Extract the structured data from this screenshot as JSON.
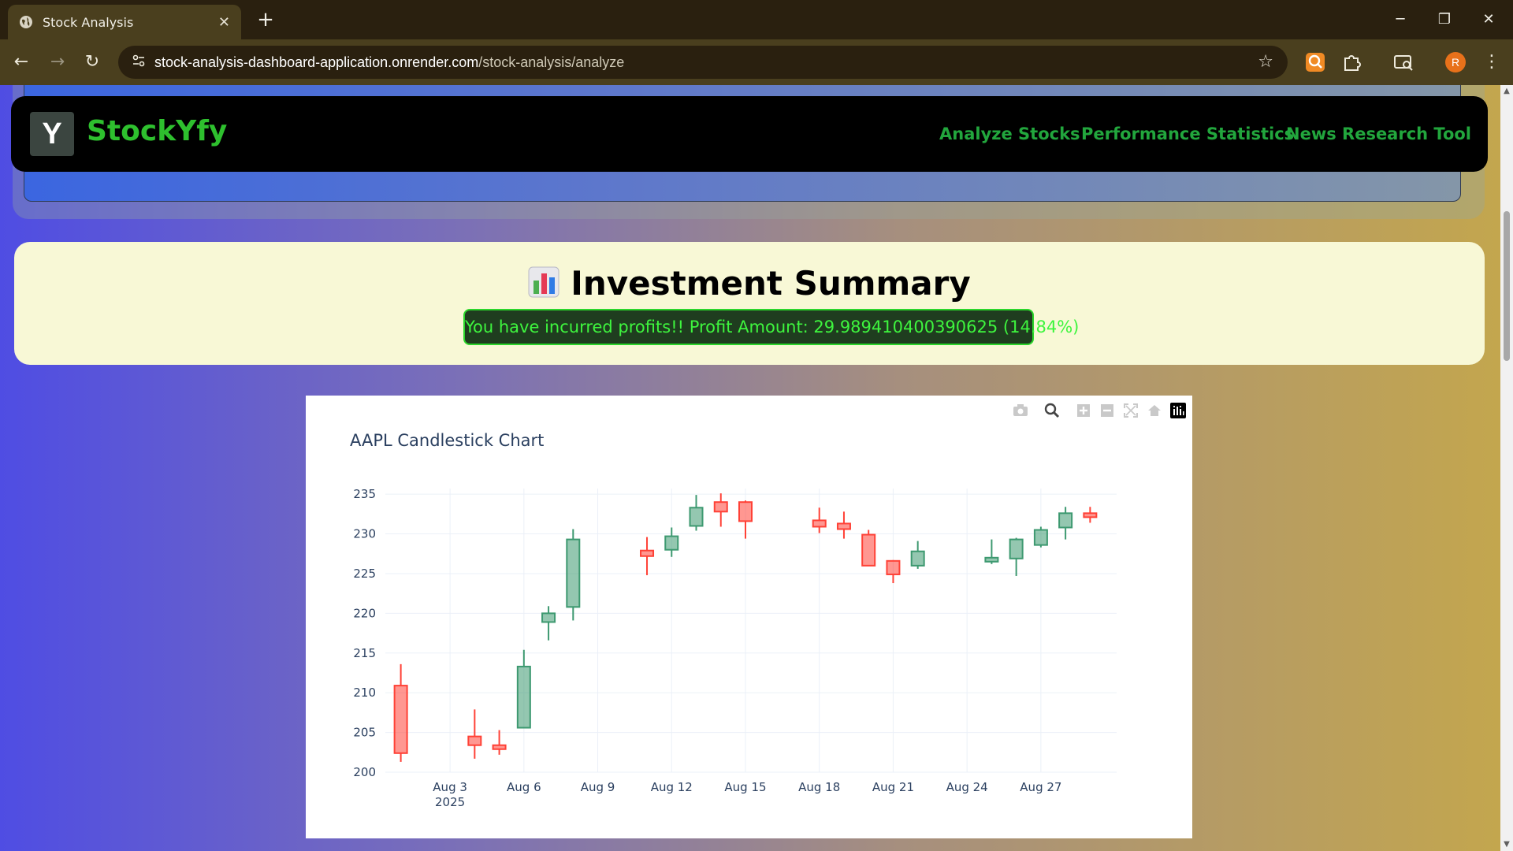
{
  "browser": {
    "tab_title": "Stock Analysis",
    "url_host": "stock-analysis-dashboard-application.onrender.com",
    "url_path": "/stock-analysis/analyze",
    "avatar_letter": "R"
  },
  "navbar": {
    "logo_letter": "Y",
    "brand": "StockYfy",
    "links": [
      "Analyze Stocks",
      "Performance Statistics",
      "News Research Tool"
    ]
  },
  "summary": {
    "title": "Investment Summary",
    "profit_text": "You have incurred profits!! Profit Amount: 29.989410400390625 (14.84%)"
  },
  "colors": {
    "brand_green": "#2ec02e",
    "increasing": "#3d9970",
    "decreasing": "#ff4136"
  },
  "chart_data": {
    "type": "candlestick",
    "title": "AAPL Candlestick Chart",
    "xlabel": "",
    "ylabel": "",
    "ylim": [
      200,
      236.5
    ],
    "yticks": [
      200,
      205,
      210,
      215,
      220,
      225,
      230,
      235
    ],
    "x_tick_labels": [
      "Aug 3\n2025",
      "Aug 6",
      "Aug 9",
      "Aug 12",
      "Aug 15",
      "Aug 18",
      "Aug 21",
      "Aug 24",
      "Aug 27"
    ],
    "grid": true,
    "candles": [
      {
        "date": "2025-08-01",
        "open": 210.9,
        "high": 213.6,
        "low": 201.3,
        "close": 202.4
      },
      {
        "date": "2025-08-04",
        "open": 204.5,
        "high": 207.9,
        "low": 201.7,
        "close": 203.4
      },
      {
        "date": "2025-08-05",
        "open": 203.4,
        "high": 205.3,
        "low": 202.2,
        "close": 202.9
      },
      {
        "date": "2025-08-06",
        "open": 205.6,
        "high": 215.4,
        "low": 205.6,
        "close": 213.3
      },
      {
        "date": "2025-08-07",
        "open": 218.9,
        "high": 220.9,
        "low": 216.6,
        "close": 220.0
      },
      {
        "date": "2025-08-08",
        "open": 220.8,
        "high": 230.6,
        "low": 219.1,
        "close": 229.3
      },
      {
        "date": "2025-08-11",
        "open": 227.9,
        "high": 229.6,
        "low": 224.8,
        "close": 227.2
      },
      {
        "date": "2025-08-12",
        "open": 228.0,
        "high": 230.8,
        "low": 227.1,
        "close": 229.7
      },
      {
        "date": "2025-08-13",
        "open": 231.0,
        "high": 234.9,
        "low": 230.4,
        "close": 233.3
      },
      {
        "date": "2025-08-14",
        "open": 234.0,
        "high": 235.1,
        "low": 230.9,
        "close": 232.8
      },
      {
        "date": "2025-08-15",
        "open": 234.0,
        "high": 234.2,
        "low": 229.4,
        "close": 231.6
      },
      {
        "date": "2025-08-18",
        "open": 231.7,
        "high": 233.3,
        "low": 230.1,
        "close": 230.9
      },
      {
        "date": "2025-08-19",
        "open": 231.3,
        "high": 232.8,
        "low": 229.4,
        "close": 230.6
      },
      {
        "date": "2025-08-20",
        "open": 229.9,
        "high": 230.5,
        "low": 226.0,
        "close": 226.0
      },
      {
        "date": "2025-08-21",
        "open": 226.6,
        "high": 226.7,
        "low": 223.8,
        "close": 224.9
      },
      {
        "date": "2025-08-22",
        "open": 226.0,
        "high": 229.1,
        "low": 225.6,
        "close": 227.8
      },
      {
        "date": "2025-08-25",
        "open": 226.5,
        "high": 229.3,
        "low": 226.2,
        "close": 227.0
      },
      {
        "date": "2025-08-26",
        "open": 226.9,
        "high": 229.5,
        "low": 224.7,
        "close": 229.3
      },
      {
        "date": "2025-08-27",
        "open": 228.6,
        "high": 230.9,
        "low": 228.3,
        "close": 230.5
      },
      {
        "date": "2025-08-28",
        "open": 230.8,
        "high": 233.4,
        "low": 229.3,
        "close": 232.6
      },
      {
        "date": "2025-08-29",
        "open": 232.6,
        "high": 233.4,
        "low": 231.4,
        "close": 232.1
      }
    ]
  }
}
